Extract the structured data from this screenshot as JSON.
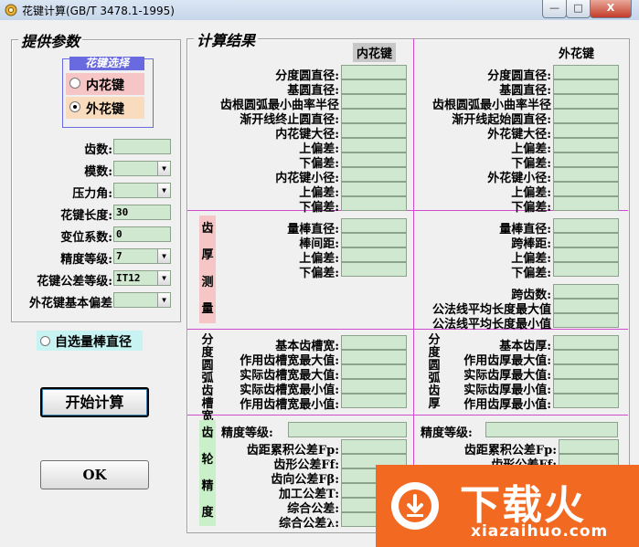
{
  "window": {
    "title": "花键计算(GB/T 3478.1-1995)",
    "min_label": "—",
    "max_label": "□",
    "close_label": "X"
  },
  "left": {
    "legend": "提供参数",
    "spline_type": {
      "legend": "花键选择",
      "options": [
        "内花键",
        "外花键"
      ],
      "selected": "外花键"
    },
    "fields": [
      {
        "label": "齿数:",
        "value": ""
      },
      {
        "label": "模数:",
        "value": ""
      },
      {
        "label": "压力角:",
        "value": ""
      },
      {
        "label": "花键长度:",
        "value": "30"
      },
      {
        "label": "变位系数:",
        "value": "0"
      },
      {
        "label": "精度等级:",
        "value": "7"
      },
      {
        "label": "花键公差等级:",
        "value": "IT12"
      },
      {
        "label": "外花键基本偏差",
        "value": ""
      }
    ],
    "custom_rod": {
      "label": "自选量棒直径"
    },
    "start_button": "开始计算",
    "ok_button": "OK"
  },
  "results": {
    "legend": "计算结果",
    "internal_header": "内花键",
    "external_header": "外花键",
    "internal_basic": [
      "分度圆直径:",
      "基圆直径:",
      "齿根圆弧最小曲率半径",
      "渐开线终止圆直径:",
      "内花键大径:",
      "上偏差:",
      "下偏差:",
      "内花键小径:",
      "上偏差:",
      "下偏差:"
    ],
    "external_basic": [
      "分度圆直径:",
      "基圆直径:",
      "齿根圆弧最小曲率半径",
      "渐开线起始圆直径:",
      "外花键大径:",
      "上偏差:",
      "下偏差:",
      "外花键小径:",
      "上偏差:",
      "下偏差:"
    ],
    "tooth_thickness": {
      "side_chars": [
        "齿",
        "厚",
        "测",
        "量"
      ],
      "internal": [
        "量棒直径:",
        "棒间距:",
        "上偏差:",
        "下偏差:"
      ],
      "external": [
        "量棒直径:",
        "跨棒距:",
        "上偏差:",
        "下偏差:"
      ],
      "external_span": [
        "跨齿数:",
        "公法线平均长度最大值",
        "公法线平均长度最小值"
      ]
    },
    "arc_section": {
      "side_chars_internal": [
        "分",
        "度",
        "圆",
        "弧",
        "齿",
        "槽",
        "宽"
      ],
      "side_chars_external": [
        "分",
        "度",
        "圆",
        "弧",
        "齿",
        "厚"
      ],
      "internal": [
        "基本齿槽宽:",
        "作用齿槽宽最大值:",
        "实际齿槽宽最大值:",
        "实际齿槽宽最小值:",
        "作用齿槽宽最小值:"
      ],
      "external": [
        "基本齿厚:",
        "作用齿厚最大值:",
        "实际齿厚最大值:",
        "实际齿厚最小值:",
        "作用齿厚最小值:"
      ]
    },
    "precision": {
      "side_chars": [
        "齿",
        "轮",
        "精",
        "度"
      ],
      "internal_grade_label": "精度等级:",
      "internal": [
        "齿距累积公差Fp:",
        "齿形公差Ff:",
        "齿向公差Fβ:",
        "加工公差T:",
        "综合公差:",
        "综合公差λ:"
      ],
      "external_grade_label": "精度等级:",
      "external": [
        "齿距累积公差Fp:",
        "齿形公差Ff:"
      ]
    }
  },
  "watermark": {
    "brand": "下载火",
    "domain": "xiazaihuo.com"
  },
  "colors": {
    "field_bg": "#cfe8cf",
    "divider": "#d04bd0",
    "pink_strip": "#f6c6c6",
    "green_strip": "#c9f0c9",
    "radio_internal_bg": "#f6c6c6",
    "radio_external_bg": "#f9dcbd",
    "spline_select_legend_bg": "#6a6ae0",
    "custom_rod_bg": "#c8f3f3",
    "watermark_orange": "#f26a21"
  }
}
